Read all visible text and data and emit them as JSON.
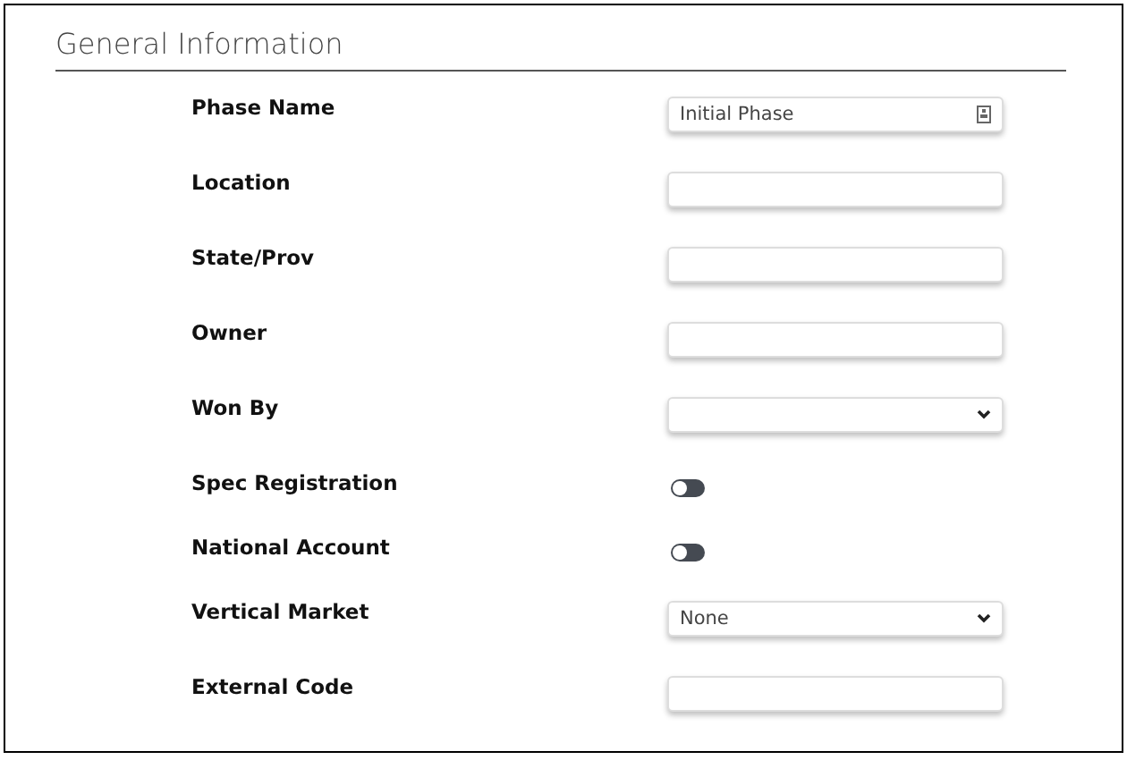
{
  "section": {
    "title": "General Information"
  },
  "fields": [
    {
      "label": "Phase Name",
      "kind": "text",
      "value": "Initial Phase",
      "icon": true
    },
    {
      "label": "Location",
      "kind": "text"
    },
    {
      "label": "State/Prov",
      "kind": "text"
    },
    {
      "label": "Owner",
      "kind": "text"
    },
    {
      "label": "Won By",
      "kind": "select"
    },
    {
      "label": "Spec Registration",
      "kind": "toggle",
      "on": false
    },
    {
      "label": "National Account",
      "kind": "toggle",
      "on": false
    },
    {
      "label": "Vertical Market",
      "kind": "select",
      "value": "None"
    },
    {
      "label": "External Code",
      "kind": "text"
    }
  ]
}
